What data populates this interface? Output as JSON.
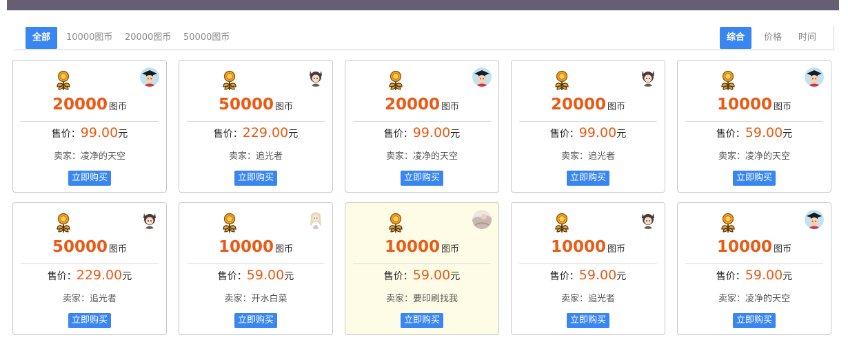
{
  "filters": {
    "left_tabs": [
      "全部",
      "10000图币",
      "20000图币",
      "50000图币"
    ],
    "right_tabs": [
      "综合",
      "价格",
      "时间"
    ]
  },
  "labels": {
    "unit": "图币",
    "price_prefix": "售价：",
    "currency": "元",
    "seller_prefix": "卖家：",
    "buy_button": "立即购买"
  },
  "accent_color": "#3a86f0",
  "amount_color": "#ea5a14",
  "cards": [
    {
      "amount": "20000",
      "price": "99.00",
      "seller": "凌净的天空",
      "avatar": "graduate-avatar"
    },
    {
      "amount": "50000",
      "price": "229.00",
      "seller": "追光者",
      "avatar": "cat-girl-avatar"
    },
    {
      "amount": "20000",
      "price": "99.00",
      "seller": "凌净的天空",
      "avatar": "graduate-avatar"
    },
    {
      "amount": "20000",
      "price": "99.00",
      "seller": "追光者",
      "avatar": "cat-girl-avatar"
    },
    {
      "amount": "10000",
      "price": "59.00",
      "seller": "凌净的天空",
      "avatar": "graduate-avatar"
    },
    {
      "amount": "50000",
      "price": "229.00",
      "seller": "追光者",
      "avatar": "cat-girl-avatar"
    },
    {
      "amount": "10000",
      "price": "59.00",
      "seller": "开水白菜",
      "avatar": "anime-girl-avatar"
    },
    {
      "amount": "10000",
      "price": "59.00",
      "seller": "要印刷找我",
      "avatar": "photo-avatar",
      "highlight": true
    },
    {
      "amount": "10000",
      "price": "59.00",
      "seller": "追光者",
      "avatar": "cat-girl-avatar"
    },
    {
      "amount": "10000",
      "price": "59.00",
      "seller": "凌净的天空",
      "avatar": "graduate-avatar"
    }
  ]
}
